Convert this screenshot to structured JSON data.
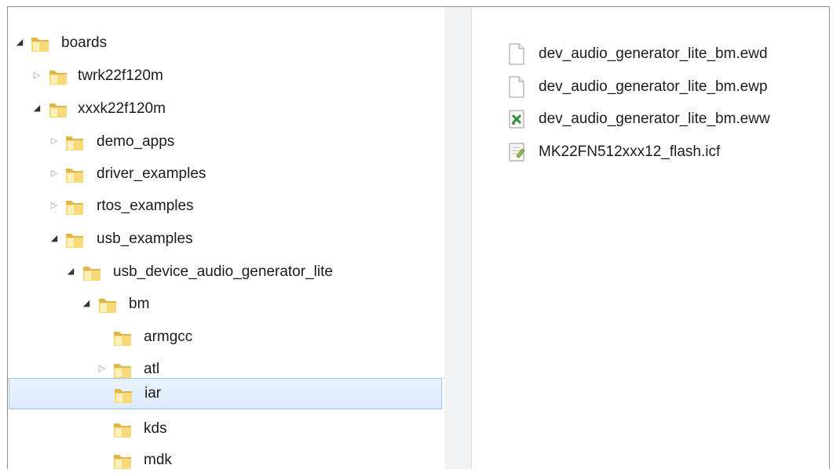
{
  "navigation_tree": {
    "items": [
      {
        "label": "boards",
        "state": "expanded",
        "level": 0
      },
      {
        "label": "twrk22f120m",
        "state": "collapsed",
        "level": 1
      },
      {
        "label": "xxxk22f120m",
        "state": "expanded",
        "level": 1
      },
      {
        "label": "demo_apps",
        "state": "collapsed",
        "level": 2
      },
      {
        "label": "driver_examples",
        "state": "collapsed",
        "level": 2
      },
      {
        "label": "rtos_examples",
        "state": "collapsed",
        "level": 2
      },
      {
        "label": "usb_examples",
        "state": "expanded",
        "level": 2
      },
      {
        "label": "usb_device_audio_generator_lite",
        "state": "expanded",
        "level": 3
      },
      {
        "label": "bm",
        "state": "expanded",
        "level": 4
      },
      {
        "label": "armgcc",
        "state": "none",
        "level": 5
      },
      {
        "label": "atl",
        "state": "collapsed",
        "level": 5
      },
      {
        "label": "iar",
        "state": "none",
        "level": 5,
        "selected": true
      },
      {
        "label": "kds",
        "state": "none",
        "level": 5
      },
      {
        "label": "mdk",
        "state": "none",
        "level": 5
      }
    ]
  },
  "file_list": {
    "files": [
      {
        "name": "dev_audio_generator_lite_bm.ewd",
        "icon": "blank-file-icon"
      },
      {
        "name": "dev_audio_generator_lite_bm.ewp",
        "icon": "blank-file-icon"
      },
      {
        "name": "dev_audio_generator_lite_bm.eww",
        "icon": "workspace-file-icon"
      },
      {
        "name": "MK22FN512xxx12_flash.icf",
        "icon": "config-file-icon"
      }
    ]
  },
  "colors": {
    "folder": "#e8c25a",
    "selection_background": "#dbeafb",
    "selection_border": "#9cc3ec",
    "splitter": "#f1f2f4"
  }
}
